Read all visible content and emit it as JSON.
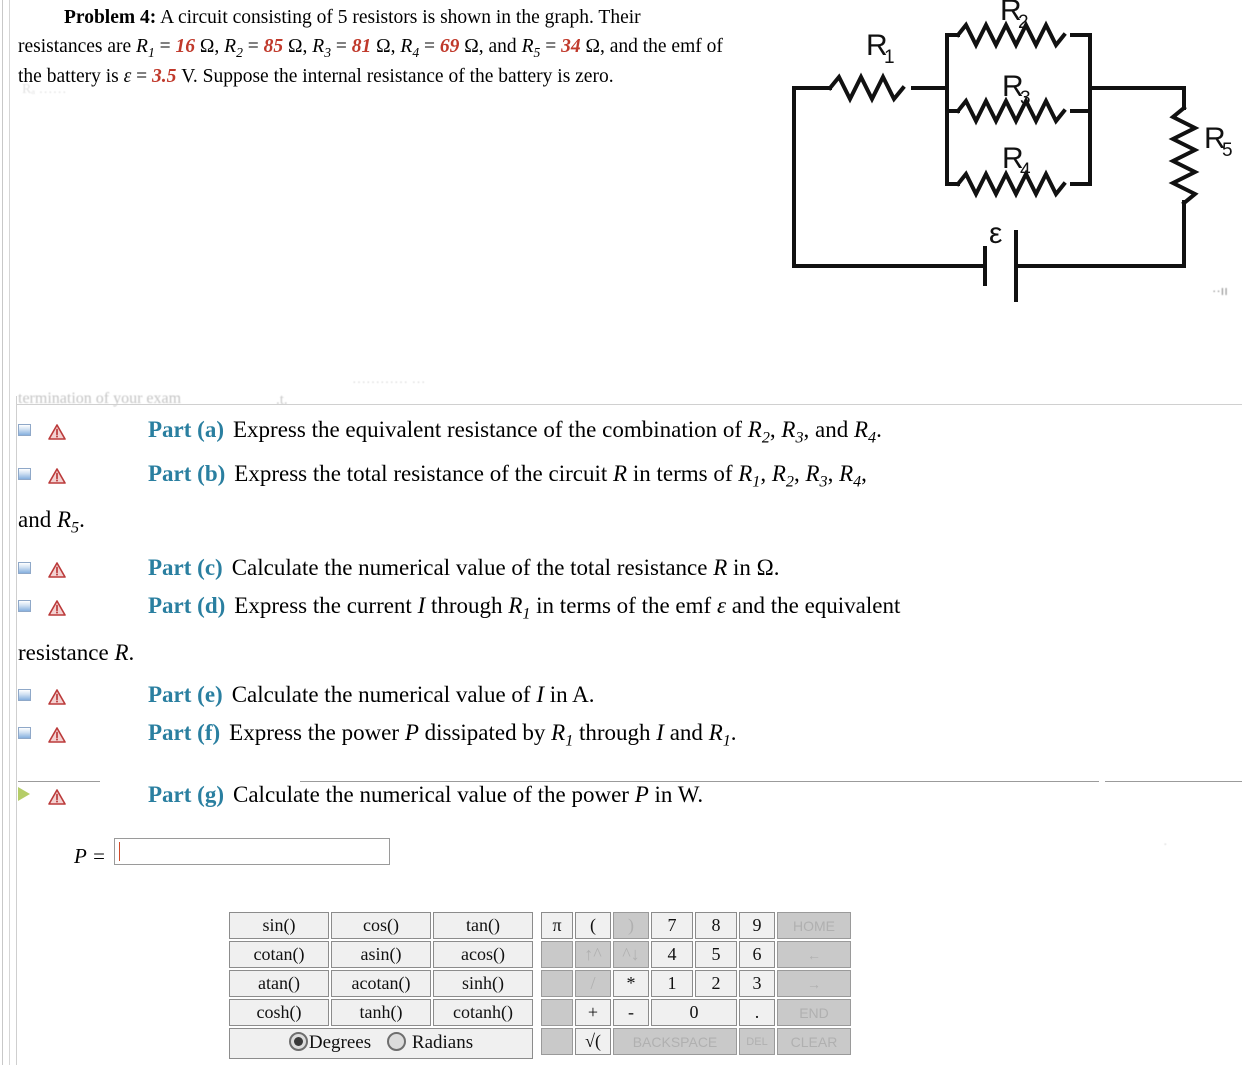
{
  "problem": {
    "title": "Problem 4:",
    "line1_a": "A circuit consisting of 5 resistors is shown in the graph. Their",
    "line2_lead": "resistances are",
    "line3_lead": "the battery is",
    "line3_tail": "V. Suppose the internal resistance of the battery is zero.",
    "resistors": [
      {
        "symbol": "R",
        "sub": "1",
        "value": "16",
        "unit": "Ω"
      },
      {
        "symbol": "R",
        "sub": "2",
        "value": "85",
        "unit": "Ω"
      },
      {
        "symbol": "R",
        "sub": "3",
        "value": "81",
        "unit": "Ω"
      },
      {
        "symbol": "R",
        "sub": "4",
        "value": "69",
        "unit": "Ω"
      },
      {
        "symbol": "R",
        "sub": "5",
        "value": "34",
        "unit": "Ω"
      }
    ],
    "emf_symbol": "ε",
    "emf_value": "3.5",
    "emf_unit": "V",
    "and_text": "and",
    "and_the_emf_of": ", and the emf of"
  },
  "circuit": {
    "labels": {
      "r1": "R",
      "r1_sub": "1",
      "r2": "R",
      "r2_sub": "2",
      "r3": "R",
      "r3_sub": "3",
      "r4": "R",
      "r4_sub": "4",
      "r5": "R",
      "r5_sub": "5",
      "emf": "ε"
    }
  },
  "ghosts": {
    "top": "Rₐ   ……",
    "termination": "termination of your exam",
    "right_upper": "………… …",
    "dots": ".t.",
    "corner": "··ıı",
    "right_g": "·"
  },
  "parts": [
    {
      "id": "a",
      "label": "Part (a)",
      "text": "Express the equivalent resistance of the combination of R2, R3, and R4.",
      "icon_state": "collapsed",
      "continuation": null
    },
    {
      "id": "b",
      "label": "Part (b)",
      "text": "Express the total resistance of the circuit R in terms of R1, R2, R3, R4,",
      "icon_state": "collapsed",
      "continuation": "and R5."
    },
    {
      "id": "c",
      "label": "Part (c)",
      "text": "Calculate the numerical value of the total resistance R in Ω.",
      "icon_state": "collapsed",
      "continuation": null
    },
    {
      "id": "d",
      "label": "Part (d)",
      "text": "Express the current I through R1 in terms of the emf ε and the equivalent",
      "icon_state": "collapsed",
      "continuation": "resistance R."
    },
    {
      "id": "e",
      "label": "Part (e)",
      "text": "Calculate the numerical value of I in A.",
      "icon_state": "collapsed",
      "continuation": null
    },
    {
      "id": "f",
      "label": "Part (f)",
      "text": "Express the power P dissipated by R1 through I and R1.",
      "icon_state": "collapsed",
      "continuation": null
    },
    {
      "id": "g",
      "label": "Part (g)",
      "text": "Calculate the numerical value of the power P in W.",
      "icon_state": "expanded",
      "continuation": null
    }
  ],
  "answer": {
    "label": "P =",
    "value": "",
    "placeholder": ""
  },
  "calculator": {
    "function_rows": [
      [
        "sin()",
        "cos()",
        "tan()"
      ],
      [
        "cotan()",
        "asin()",
        "acos()"
      ],
      [
        "atan()",
        "acotan()",
        "sinh()"
      ],
      [
        "cosh()",
        "tanh()",
        "cotanh()"
      ]
    ],
    "angle_mode": {
      "degrees_label": "Degrees",
      "radians_label": "Radians",
      "selected": "Degrees"
    },
    "numeric_rows": [
      [
        {
          "label": "π",
          "cls": "pi",
          "enabled": true
        },
        {
          "label": "(",
          "cls": "",
          "enabled": true
        },
        {
          "label": ")",
          "cls": "",
          "enabled": false
        },
        {
          "label": "7",
          "cls": "",
          "enabled": true
        },
        {
          "label": "8",
          "cls": "",
          "enabled": true
        },
        {
          "label": "9",
          "cls": "",
          "enabled": true
        },
        {
          "label": "HOME",
          "cls": "nav",
          "enabled": false
        }
      ],
      [
        {
          "label": "",
          "cls": "pi",
          "enabled": false,
          "blank": true
        },
        {
          "label": "↑^",
          "cls": "",
          "enabled": false
        },
        {
          "label": "^↓",
          "cls": "",
          "enabled": false
        },
        {
          "label": "4",
          "cls": "",
          "enabled": true
        },
        {
          "label": "5",
          "cls": "",
          "enabled": true
        },
        {
          "label": "6",
          "cls": "",
          "enabled": true
        },
        {
          "label": "←",
          "cls": "nav",
          "enabled": false
        }
      ],
      [
        {
          "label": "",
          "cls": "pi",
          "enabled": false,
          "blank": true
        },
        {
          "label": "/",
          "cls": "",
          "enabled": false
        },
        {
          "label": "*",
          "cls": "",
          "enabled": true
        },
        {
          "label": "1",
          "cls": "",
          "enabled": true
        },
        {
          "label": "2",
          "cls": "",
          "enabled": true
        },
        {
          "label": "3",
          "cls": "",
          "enabled": true
        },
        {
          "label": "→",
          "cls": "nav",
          "enabled": false
        }
      ],
      [
        {
          "label": "",
          "cls": "pi",
          "enabled": false,
          "blank": true
        },
        {
          "label": "+",
          "cls": "",
          "enabled": true
        },
        {
          "label": "-",
          "cls": "",
          "enabled": true
        },
        {
          "label": "0",
          "cls": "wide",
          "enabled": true
        },
        {
          "label": ".",
          "cls": "",
          "enabled": true
        },
        {
          "label": "END",
          "cls": "nav",
          "enabled": false
        }
      ],
      [
        {
          "label": "",
          "cls": "pi",
          "enabled": false,
          "blank": true
        },
        {
          "label": "√(",
          "cls": "",
          "enabled": true
        },
        {
          "label": "BACKSPACE",
          "cls": "bksp",
          "enabled": false
        },
        {
          "label": "DEL",
          "cls": "del",
          "enabled": false
        },
        {
          "label": "CLEAR",
          "cls": "nav",
          "enabled": false
        }
      ]
    ]
  },
  "colors": {
    "part_label": "#2a7fa0",
    "value_red": "#c0392b",
    "caret": "#d04a2a",
    "warn_triangle": "#c0392b",
    "collapsed_icon": "#86b0de",
    "expanded_icon": "#b5cd68"
  }
}
